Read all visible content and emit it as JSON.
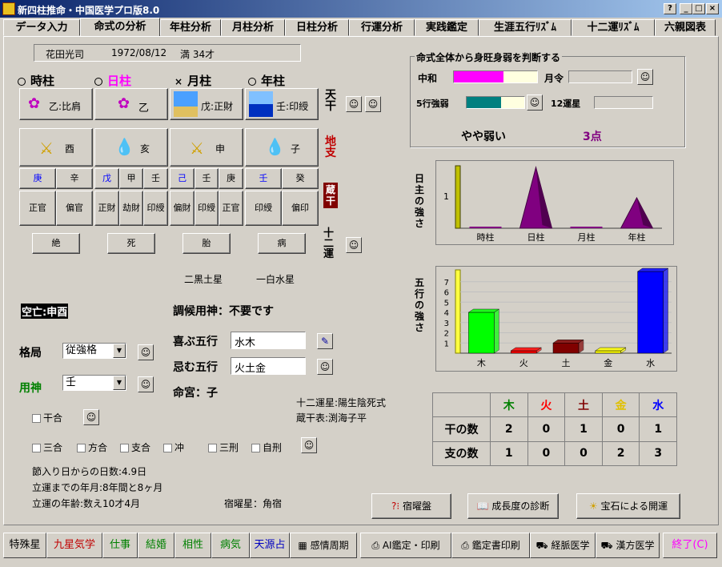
{
  "window": {
    "title": "新四柱推命・中国医学プロ版8.0",
    "btn_help": "?",
    "btn_min": "_",
    "btn_max": "□",
    "btn_close": "×"
  },
  "tabs": [
    "データ入力",
    "命式の分析",
    "年柱分析",
    "月柱分析",
    "日柱分析",
    "行運分析",
    "実践鑑定",
    "生涯五行ﾘｽﾞﾑ",
    "十二運ﾘｽﾞﾑ",
    "六親図表"
  ],
  "person": {
    "name": "花田光司",
    "birth": "1972/08/12",
    "age": "満 34才"
  },
  "pillars": {
    "labels": [
      "時柱",
      "日柱",
      "月柱",
      "年柱"
    ],
    "marks": [
      "○",
      "○",
      "×",
      "○"
    ],
    "tenkan": [
      {
        "char": "乙",
        "star": "比肩"
      },
      {
        "char": "乙",
        "star": ""
      },
      {
        "char": "戊",
        "star": "正財"
      },
      {
        "char": "壬",
        "star": "印綬"
      }
    ],
    "chishi": [
      "酉",
      "亥",
      "申",
      "子"
    ],
    "zokan": [
      [
        "庚",
        "辛"
      ],
      [
        "戊",
        "甲",
        "壬"
      ],
      [
        "己",
        "壬",
        "庚"
      ],
      [
        "壬",
        "癸"
      ]
    ],
    "zokan_stars": [
      [
        "正官",
        "偏官"
      ],
      [
        "正財",
        "劫財",
        "印綬"
      ],
      [
        "偏財",
        "印綬",
        "正官"
      ],
      [
        "印綬",
        "偏印"
      ]
    ],
    "juniun": [
      "絶",
      "死",
      "胎",
      "病"
    ]
  },
  "side": {
    "tenkan": "天干",
    "chishi": "地支",
    "zokan": "蔵干",
    "juniun": "十二運"
  },
  "kyusei": [
    "二黒土星",
    "一白水星"
  ],
  "kubo": "空亡:申酉",
  "chokou": "調候用神：不要です",
  "kakkyoku": {
    "label": "格局",
    "value": "従強格"
  },
  "youjin": {
    "label": "用神",
    "value": "壬"
  },
  "yorokobu": {
    "label": "喜ぶ五行",
    "value": "水木"
  },
  "imu": {
    "label": "忌む五行",
    "value": "火土金"
  },
  "meikyu": "命宮：子",
  "juniunsei": "十二運星:陽生陰死式",
  "zokanhyo": "蔵干表:渕海子平",
  "checks": {
    "kangou": "干合",
    "items": [
      "三合",
      "方合",
      "支合",
      "冲",
      "三刑",
      "自刑"
    ]
  },
  "info": [
    "節入り日からの日数:4.9日",
    "立運までの年月:8年間と8ヶ月",
    "立運の年齢:数え10才4月"
  ],
  "shukuyo": "宿曜星：角宿",
  "judge": {
    "title": "命式全体から身旺身弱を判断する",
    "chuwa": "中和",
    "gekkei": "月令",
    "gogyo": "5行強弱",
    "juni": "12運星",
    "result": "やや弱い",
    "points": "3点",
    "chuwa_ratio": 0.6,
    "gogyo_ratio": 0.6
  },
  "chart1": {
    "ylabel": "日主の強さ"
  },
  "chart2": {
    "ylabel": "五行の強さ"
  },
  "chart_data": [
    {
      "type": "bar",
      "categories": [
        "時柱",
        "日柱",
        "月柱",
        "年柱"
      ],
      "values": [
        0,
        2,
        0,
        1
      ],
      "ylabel": "日主の強さ",
      "yticks": [
        "1"
      ],
      "colors": [
        "#800080"
      ]
    },
    {
      "type": "bar",
      "categories": [
        "木",
        "火",
        "土",
        "金",
        "水"
      ],
      "values": [
        4,
        0,
        1,
        0,
        8
      ],
      "ylabel": "五行の強さ",
      "yticks": [
        "1",
        "2",
        "3",
        "4",
        "5",
        "6",
        "7"
      ],
      "colors": [
        "#00ff00",
        "#ff0000",
        "#800000",
        "#ffff00",
        "#0000ff"
      ]
    }
  ],
  "table": {
    "header": [
      "",
      "木",
      "火",
      "土",
      "金",
      "水"
    ],
    "colors": [
      "#000",
      "#008000",
      "#ff0000",
      "#800000",
      "#e0c000",
      "#0000ff"
    ],
    "rows": [
      {
        "label": "干の数",
        "values": [
          "2",
          "0",
          "1",
          "0",
          "1"
        ]
      },
      {
        "label": "支の数",
        "values": [
          "1",
          "0",
          "0",
          "2",
          "3"
        ]
      }
    ]
  },
  "buttons": {
    "shukuyoban": "宿曜盤",
    "seichou": "成長度の診断",
    "houseki": "宝石による開運"
  },
  "bottom": [
    "特殊星",
    "九星気学",
    "仕事",
    "結婚",
    "相性",
    "病気",
    "天源占",
    "感情周期",
    "AI鑑定・印刷",
    "鑑定書印刷",
    "経脈医学",
    "漢方医学",
    "終了(C)"
  ]
}
